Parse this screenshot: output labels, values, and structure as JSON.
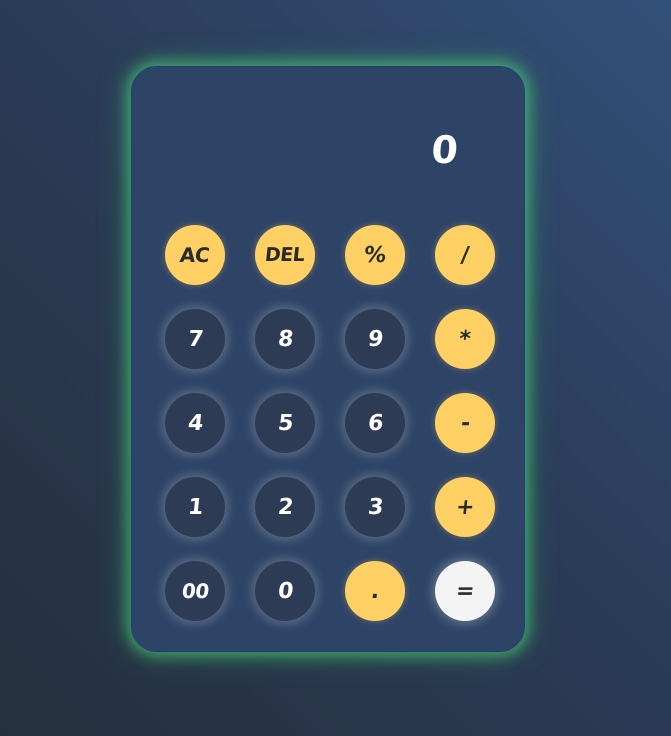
{
  "display": {
    "value": "0"
  },
  "keys": {
    "ac": "AC",
    "del": "DEL",
    "percent": "%",
    "divide": "/",
    "seven": "7",
    "eight": "8",
    "nine": "9",
    "multiply": "*",
    "four": "4",
    "five": "5",
    "six": "6",
    "subtract": "-",
    "one": "1",
    "two": "2",
    "three": "3",
    "add": "+",
    "double_zero": "00",
    "zero": "0",
    "decimal": ".",
    "equals": "="
  },
  "colors": {
    "operator_key": "#ffd064",
    "number_key": "#2d3b55",
    "equals_key": "#f4f4f4",
    "panel": "#2e4466",
    "glow": "#50e678"
  }
}
